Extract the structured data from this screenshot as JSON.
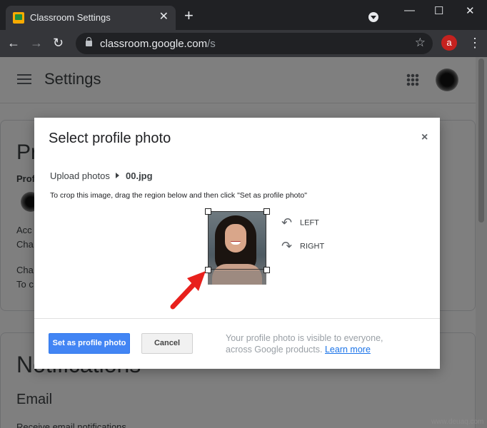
{
  "browser": {
    "tab_title": "Classroom Settings",
    "tab_close": "✕",
    "new_tab": "+",
    "url_main": "classroom.google.com",
    "url_path": "/s",
    "profile_letter": "a",
    "icons": [
      "classroom-favicon",
      "back-arrow-icon",
      "forward-arrow-icon",
      "reload-icon",
      "lock-icon",
      "star-icon",
      "menu-kebab-icon",
      "tab-search-icon"
    ]
  },
  "page": {
    "title": "Settings",
    "card1": {
      "heading_partial": "Pr",
      "profile_label_partial": "Prof",
      "account_partial": "Acc",
      "change_partial": "Cha",
      "change2_partial": "Cha",
      "to_partial": "To c"
    },
    "card2": {
      "heading": "Notifications",
      "sub": "Email",
      "desc": "Receive email notifications"
    }
  },
  "dialog": {
    "title": "Select profile photo",
    "close": "×",
    "breadcrumb_root": "Upload photos",
    "breadcrumb_file": "00.jpg",
    "instructions": "To crop this image, drag the region below and then click \"Set as profile photo\"",
    "rotate_left": "LEFT",
    "rotate_right": "RIGHT",
    "primary_button": "Set as profile photo",
    "cancel_button": "Cancel",
    "footnote": "Your profile photo is visible to everyone, across Google products.",
    "learn_more": "Learn more"
  },
  "watermark": "www.deuaq.com"
}
